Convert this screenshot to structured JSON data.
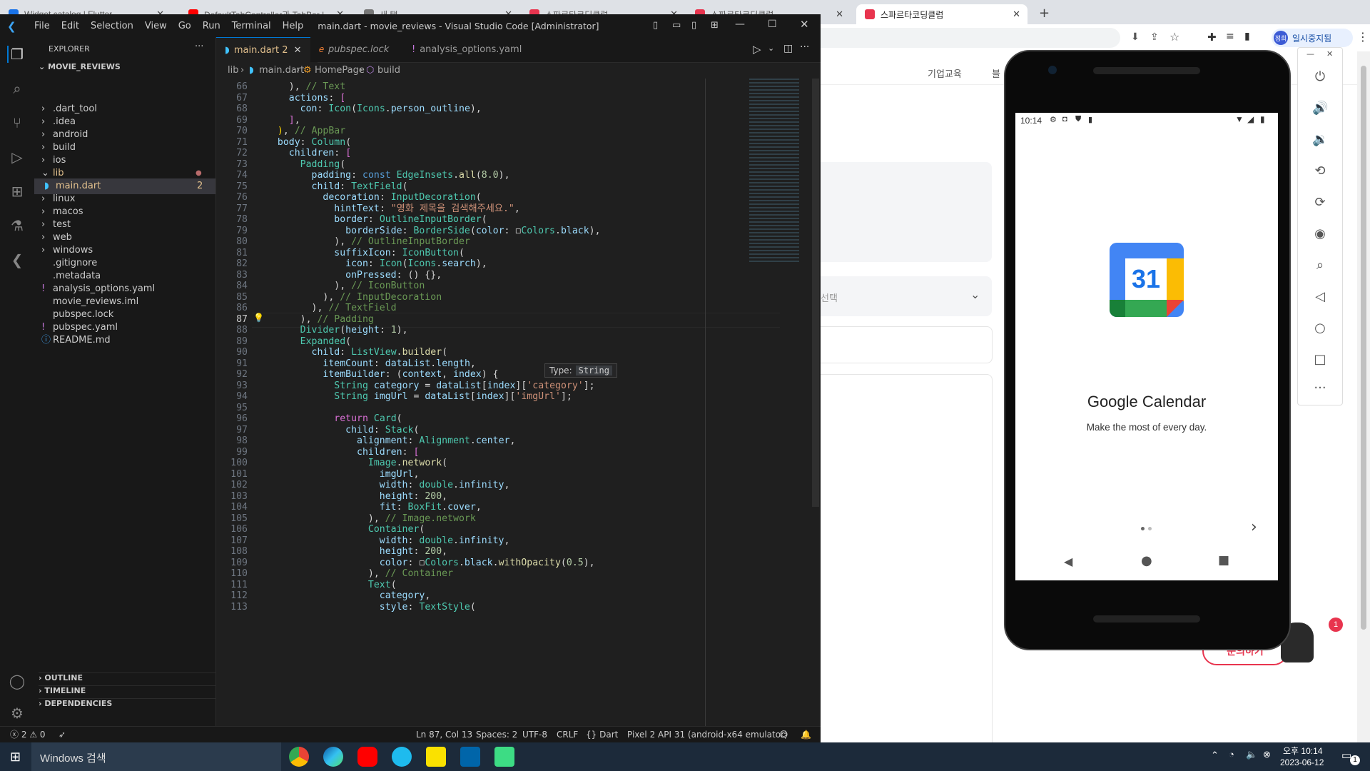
{
  "chrome": {
    "tabs": [
      {
        "title": "Widget catalog | Flutter",
        "color": "#1a73e8"
      },
      {
        "title": "DefaultTabController과 TabBar |",
        "color": "#ff0000"
      },
      {
        "title": "새 탭",
        "color": "#777777"
      },
      {
        "title": "스파르타코딩클럽",
        "color": "#e8344e"
      },
      {
        "title": "스파르타코딩클럽",
        "color": "#e8344e"
      },
      {
        "title": "스파르타코딩클럽",
        "color": "#e8344e"
      }
    ],
    "profile_label": "일시중지됨",
    "profile_avatar": "정희",
    "page_nav": [
      "기업교육",
      "블"
    ],
    "page_select_placeholder": "선택",
    "page_button": "문의하기",
    "chat_badge": "1"
  },
  "vscode": {
    "menu": [
      "File",
      "Edit",
      "Selection",
      "View",
      "Go",
      "Run",
      "Terminal",
      "Help"
    ],
    "window_title": "main.dart - movie_reviews - Visual Studio Code [Administrator]",
    "explorer_title": "EXPLORER",
    "project": "MOVIE_REVIEWS",
    "tree": [
      {
        "label": ".dart_tool",
        "type": "folder",
        "depth": 1
      },
      {
        "label": ".idea",
        "type": "folder",
        "depth": 1
      },
      {
        "label": "android",
        "type": "folder",
        "depth": 1
      },
      {
        "label": "build",
        "type": "folder",
        "depth": 1
      },
      {
        "label": "ios",
        "type": "folder",
        "depth": 1
      },
      {
        "label": "lib",
        "type": "folder-open",
        "depth": 1
      },
      {
        "label": "main.dart",
        "type": "dart",
        "depth": 2,
        "badge": "2"
      },
      {
        "label": "linux",
        "type": "folder",
        "depth": 1
      },
      {
        "label": "macos",
        "type": "folder",
        "depth": 1
      },
      {
        "label": "test",
        "type": "folder",
        "depth": 1
      },
      {
        "label": "web",
        "type": "folder",
        "depth": 1
      },
      {
        "label": "windows",
        "type": "folder",
        "depth": 1
      },
      {
        "label": ".gitignore",
        "type": "file",
        "depth": 1
      },
      {
        "label": ".metadata",
        "type": "file",
        "depth": 1
      },
      {
        "label": "analysis_options.yaml",
        "type": "yaml",
        "depth": 1
      },
      {
        "label": "movie_reviews.iml",
        "type": "file",
        "depth": 1
      },
      {
        "label": "pubspec.lock",
        "type": "file",
        "depth": 1
      },
      {
        "label": "pubspec.yaml",
        "type": "yaml",
        "depth": 1
      },
      {
        "label": "README.md",
        "type": "info",
        "depth": 1
      }
    ],
    "sections": [
      "OUTLINE",
      "TIMELINE",
      "DEPENDENCIES"
    ],
    "tabs": [
      {
        "label": "main.dart",
        "badge": "2",
        "active": true
      },
      {
        "label": "pubspec.lock",
        "badge": "",
        "active": false
      },
      {
        "label": "analysis_options.yaml",
        "badge": "",
        "active": false
      }
    ],
    "breadcrumb": [
      "lib",
      "main.dart",
      "HomePage",
      "build"
    ],
    "hover_tooltip": {
      "label": "Type:",
      "value": "String"
    },
    "status": {
      "errors": "2",
      "warnings": "0",
      "position": "Ln 87, Col 13",
      "spaces": "Spaces: 2",
      "encoding": "UTF-8",
      "eol": "CRLF",
      "language": "Dart",
      "device": "Pixel 2 API 31 (android-x64 emulator)"
    },
    "code": [
      {
        "n": "66",
        "html": "    ), <span class='c'>// Text</span>"
      },
      {
        "n": "67",
        "html": "    <span class='p'>actions</span>: <span class='m'>[</span>"
      },
      {
        "n": "68",
        "html": "      <span class='p'>con</span>: <span class='t'>Icon</span>(<span class='t'>Icons</span>.<span class='p'>person_outline</span>),"
      },
      {
        "n": "69",
        "html": "    <span class='m'>]</span>,"
      },
      {
        "n": "70",
        "html": "  <span class='y'>)</span>, <span class='c'>// AppBar</span>"
      },
      {
        "n": "71",
        "html": "  <span class='p'>body</span>: <span class='t'>Column</span>("
      },
      {
        "n": "72",
        "html": "    <span class='p'>children</span>: <span class='m'>[</span>"
      },
      {
        "n": "73",
        "html": "      <span class='t'>Padding</span>("
      },
      {
        "n": "74",
        "html": "        <span class='p'>padding</span>: <span class='k'>const</span> <span class='t'>EdgeInsets</span>.<span class='f'>all</span>(<span class='n'>8.0</span>),"
      },
      {
        "n": "75",
        "html": "        <span class='p'>child</span>: <span class='t'>TextField</span>("
      },
      {
        "n": "76",
        "html": "          <span class='p'>decoration</span>: <span class='t'>InputDecoration</span>("
      },
      {
        "n": "77",
        "html": "            <span class='p'>hintText</span>: <span class='s'>\"영화 제목을 검색해주세요.\"</span>,"
      },
      {
        "n": "78",
        "html": "            <span class='p'>border</span>: <span class='t'>OutlineInputBorder</span>("
      },
      {
        "n": "79",
        "html": "              <span class='p'>borderSide</span>: <span class='t'>BorderSide</span>(<span class='p'>color</span>: ◻<span class='t'>Colors</span>.<span class='p'>black</span>),"
      },
      {
        "n": "80",
        "html": "            ), <span class='c'>// OutlineInputBorder</span>"
      },
      {
        "n": "81",
        "html": "            <span class='p'>suffixIcon</span>: <span class='t'>IconButton</span>("
      },
      {
        "n": "82",
        "html": "              <span class='p'>icon</span>: <span class='t'>Icon</span>(<span class='t'>Icons</span>.<span class='p'>search</span>),"
      },
      {
        "n": "83",
        "html": "              <span class='p'>onPressed</span>: () {},"
      },
      {
        "n": "84",
        "html": "            ), <span class='c'>// IconButton</span>"
      },
      {
        "n": "85",
        "html": "          ), <span class='c'>// InputDecoration</span>"
      },
      {
        "n": "86",
        "html": "        ), <span class='c'>// TextField</span>"
      },
      {
        "n": "87",
        "html": "      ), <span class='c'>// Padding</span>"
      },
      {
        "n": "88",
        "html": "      <span class='t'>Divider</span>(<span class='p'>height</span>: <span class='n'>1</span>),"
      },
      {
        "n": "89",
        "html": "      <span class='t'>Expanded</span>("
      },
      {
        "n": "90",
        "html": "        <span class='p'>child</span>: <span class='t'>ListView</span>.<span class='f'>builder</span>("
      },
      {
        "n": "91",
        "html": "          <span class='p'>itemCount</span>: <span class='p'>dataList</span>.<span class='p'>length</span>,"
      },
      {
        "n": "92",
        "html": "          <span class='p'>itemBuilder</span>: (<span class='p'>context</span>, <span class='p'>index</span>) {"
      },
      {
        "n": "93",
        "html": "            <span class='t'>String</span> <span class='p'>category</span> = <span class='p'>dataList</span>[<span class='p'>index</span>][<span class='s'>'category'</span>];"
      },
      {
        "n": "94",
        "html": "            <span class='t'>String</span> <span class='p'>imgUrl</span> = <span class='p'>dataList</span>[<span class='p'>index</span>][<span class='s'>'imgUrl'</span>];"
      },
      {
        "n": "95",
        "html": ""
      },
      {
        "n": "96",
        "html": "            <span class='m'>return</span> <span class='t'>Card</span>("
      },
      {
        "n": "97",
        "html": "              <span class='p'>child</span>: <span class='t'>Stack</span>("
      },
      {
        "n": "98",
        "html": "                <span class='p'>alignment</span>: <span class='t'>Alignment</span>.<span class='p'>center</span>,"
      },
      {
        "n": "99",
        "html": "                <span class='p'>children</span>: <span class='m'>[</span>"
      },
      {
        "n": "100",
        "html": "                  <span class='t'>Image</span>.<span class='f'>network</span>("
      },
      {
        "n": "101",
        "html": "                    <span class='p'>imgUrl</span>,"
      },
      {
        "n": "102",
        "html": "                    <span class='p'>width</span>: <span class='t'>double</span>.<span class='p'>infinity</span>,"
      },
      {
        "n": "103",
        "html": "                    <span class='p'>height</span>: <span class='n'>200</span>,"
      },
      {
        "n": "104",
        "html": "                    <span class='p'>fit</span>: <span class='t'>BoxFit</span>.<span class='p'>cover</span>,"
      },
      {
        "n": "105",
        "html": "                  ), <span class='c'>// Image.network</span>"
      },
      {
        "n": "106",
        "html": "                  <span class='t'>Container</span>("
      },
      {
        "n": "107",
        "html": "                    <span class='p'>width</span>: <span class='t'>double</span>.<span class='p'>infinity</span>,"
      },
      {
        "n": "108",
        "html": "                    <span class='p'>height</span>: <span class='n'>200</span>,"
      },
      {
        "n": "109",
        "html": "                    <span class='p'>color</span>: ◻<span class='t'>Colors</span>.<span class='p'>black</span>.<span class='f'>withOpacity</span>(<span class='n'>0.5</span>),"
      },
      {
        "n": "110",
        "html": "                  ), <span class='c'>// Container</span>"
      },
      {
        "n": "111",
        "html": "                  <span class='t'>Text</span>("
      },
      {
        "n": "112",
        "html": "                    <span class='p'>category</span>,"
      },
      {
        "n": "113",
        "html": "                    <span class='p'>style</span>: <span class='t'>TextStyle</span>("
      }
    ]
  },
  "emulator": {
    "status_time": "10:14",
    "app_name": "Google Calendar",
    "tagline": "Make the most of every day.",
    "calendar_day": "31"
  },
  "taskbar": {
    "search_placeholder": "Windows 검색",
    "time": "오후 10:14",
    "date": "2023-06-12",
    "notification_count": "1"
  },
  "colors": {
    "vscode_bg": "#1f1f1f",
    "vscode_panel": "#181818",
    "accent": "#0078d4",
    "error": "#f14c4c"
  }
}
